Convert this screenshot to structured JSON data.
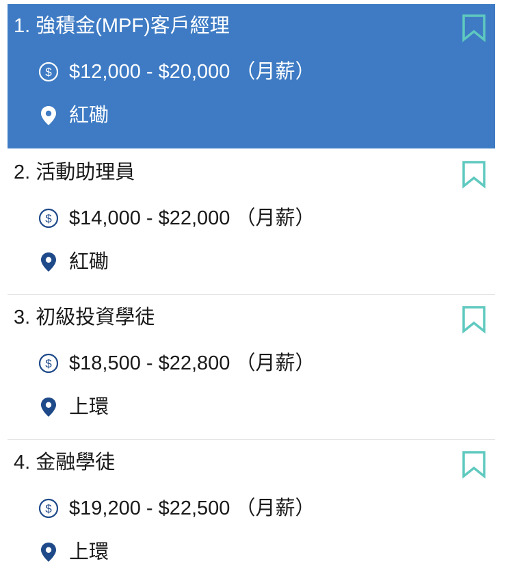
{
  "jobs": [
    {
      "title": "1. 強積金(MPF)客戶經理",
      "salary": "$12,000 - $20,000 （月薪）",
      "location": "紅磡",
      "selected": true
    },
    {
      "title": "2. 活動助理員",
      "salary": "$14,000 - $22,000 （月薪）",
      "location": "紅磡",
      "selected": false
    },
    {
      "title": "3. 初級投資學徒",
      "salary": "$18,500 - $22,800 （月薪）",
      "location": "上環",
      "selected": false
    },
    {
      "title": "4. 金融學徒",
      "salary": "$19,200 - $22,500 （月薪）",
      "location": "上環",
      "selected": false
    }
  ],
  "icons": {
    "salary": "dollar-circle-icon",
    "location": "map-pin-icon",
    "bookmark": "bookmark-icon"
  },
  "colors": {
    "selected_background": "#3e7bc4",
    "icon_blue": "#1f4a8a",
    "bookmark_teal": "#5fc9bf",
    "divider": "#e4e4e4",
    "selected_text": "#ffffff"
  }
}
